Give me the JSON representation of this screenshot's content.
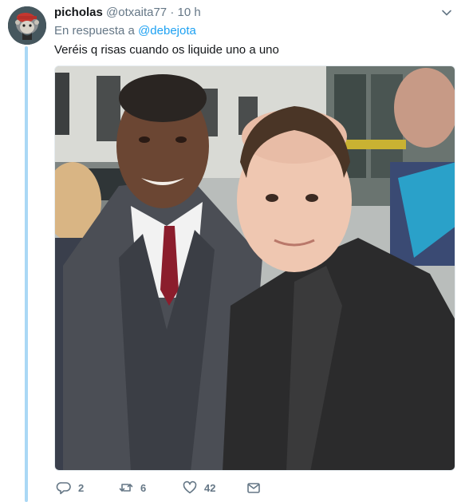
{
  "tweet": {
    "author_name": "picholas",
    "author_handle": "@otxaita77",
    "separator": "·",
    "timestamp": "10 h",
    "reply_label": "En respuesta a",
    "reply_to": "@debejota",
    "text": "Veréis q risas cuando os liquide uno a uno"
  },
  "actions": {
    "replies": "2",
    "retweets": "6",
    "likes": "42"
  },
  "icons": {
    "reply": "reply-icon",
    "retweet": "retweet-icon",
    "like": "heart-icon",
    "message": "envelope-icon",
    "menu": "chevron-down-icon"
  },
  "colors": {
    "link": "#1da1f2",
    "muted": "#657786",
    "thread_line": "#aad8f5",
    "text": "#14171a"
  }
}
